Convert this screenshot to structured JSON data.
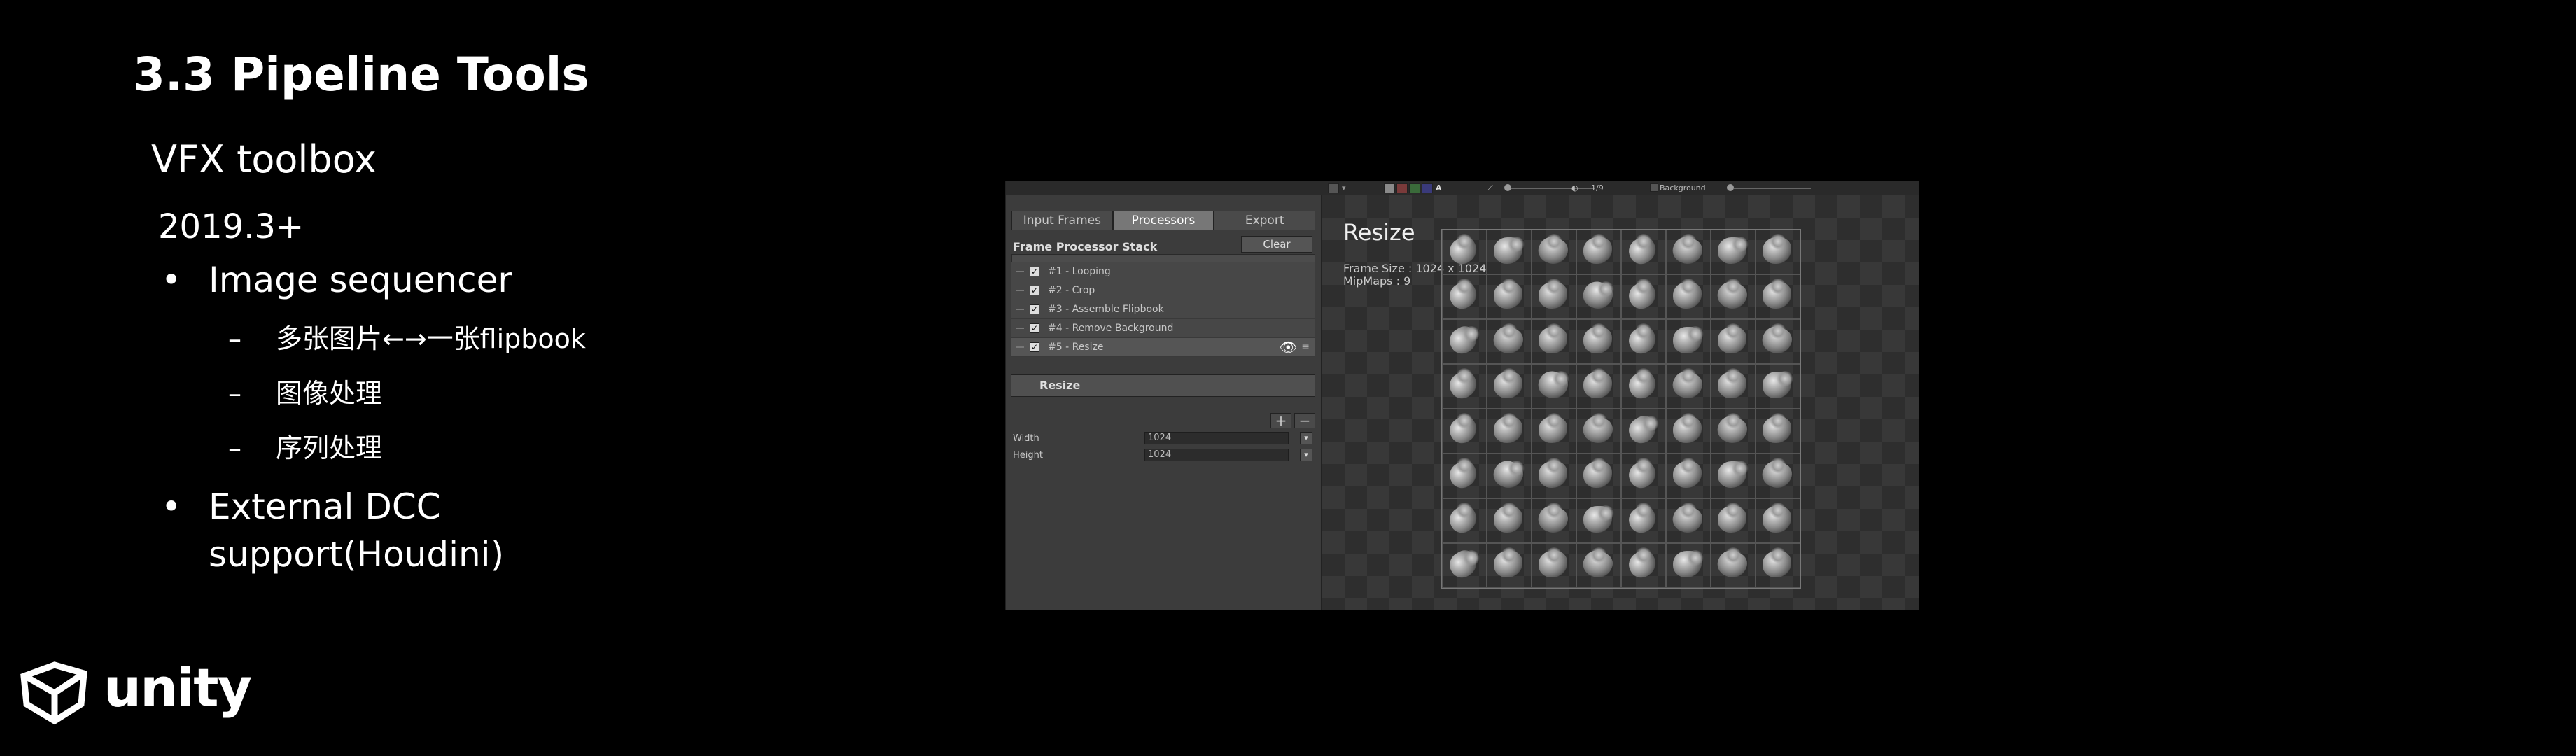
{
  "slide": {
    "title": "3.3 Pipeline Tools",
    "subtitle": "VFX toolbox",
    "version": "2019.3+",
    "bullets": [
      {
        "text": "Image sequencer",
        "sub": [
          "多张图片←→一张flipbook",
          "图像处理",
          "序列处理"
        ]
      },
      {
        "text": "External DCC support(Houdini)",
        "sub": []
      }
    ],
    "logo_text": "unity"
  },
  "editor": {
    "toolbar": {
      "frame_counter": "1/9",
      "channel_a": "A",
      "background_label": "Background"
    },
    "tabs": [
      "Input Frames",
      "Processors",
      "Export"
    ],
    "active_tab": 1,
    "stack_title": "Frame Processor Stack",
    "clear_label": "Clear",
    "processors": [
      "#1 - Looping",
      "#2 - Crop",
      "#3 - Assemble Flipbook",
      "#4 - Remove Background",
      "#5 - Resize"
    ],
    "selected_processor": 4,
    "add_label": "+",
    "remove_label": "−",
    "section_title": "Resize",
    "properties": [
      {
        "label": "Width",
        "value": "1024"
      },
      {
        "label": "Height",
        "value": "1024"
      }
    ],
    "preview": {
      "title": "Resize",
      "frame_size": "Frame Size : 1024 x 1024",
      "mipmaps": "MipMaps : 9",
      "grid_columns": 8,
      "grid_rows": 8
    }
  },
  "colors": {
    "background": "#000000",
    "text": "#ffffff",
    "editor_panel": "#3c3c3c"
  }
}
